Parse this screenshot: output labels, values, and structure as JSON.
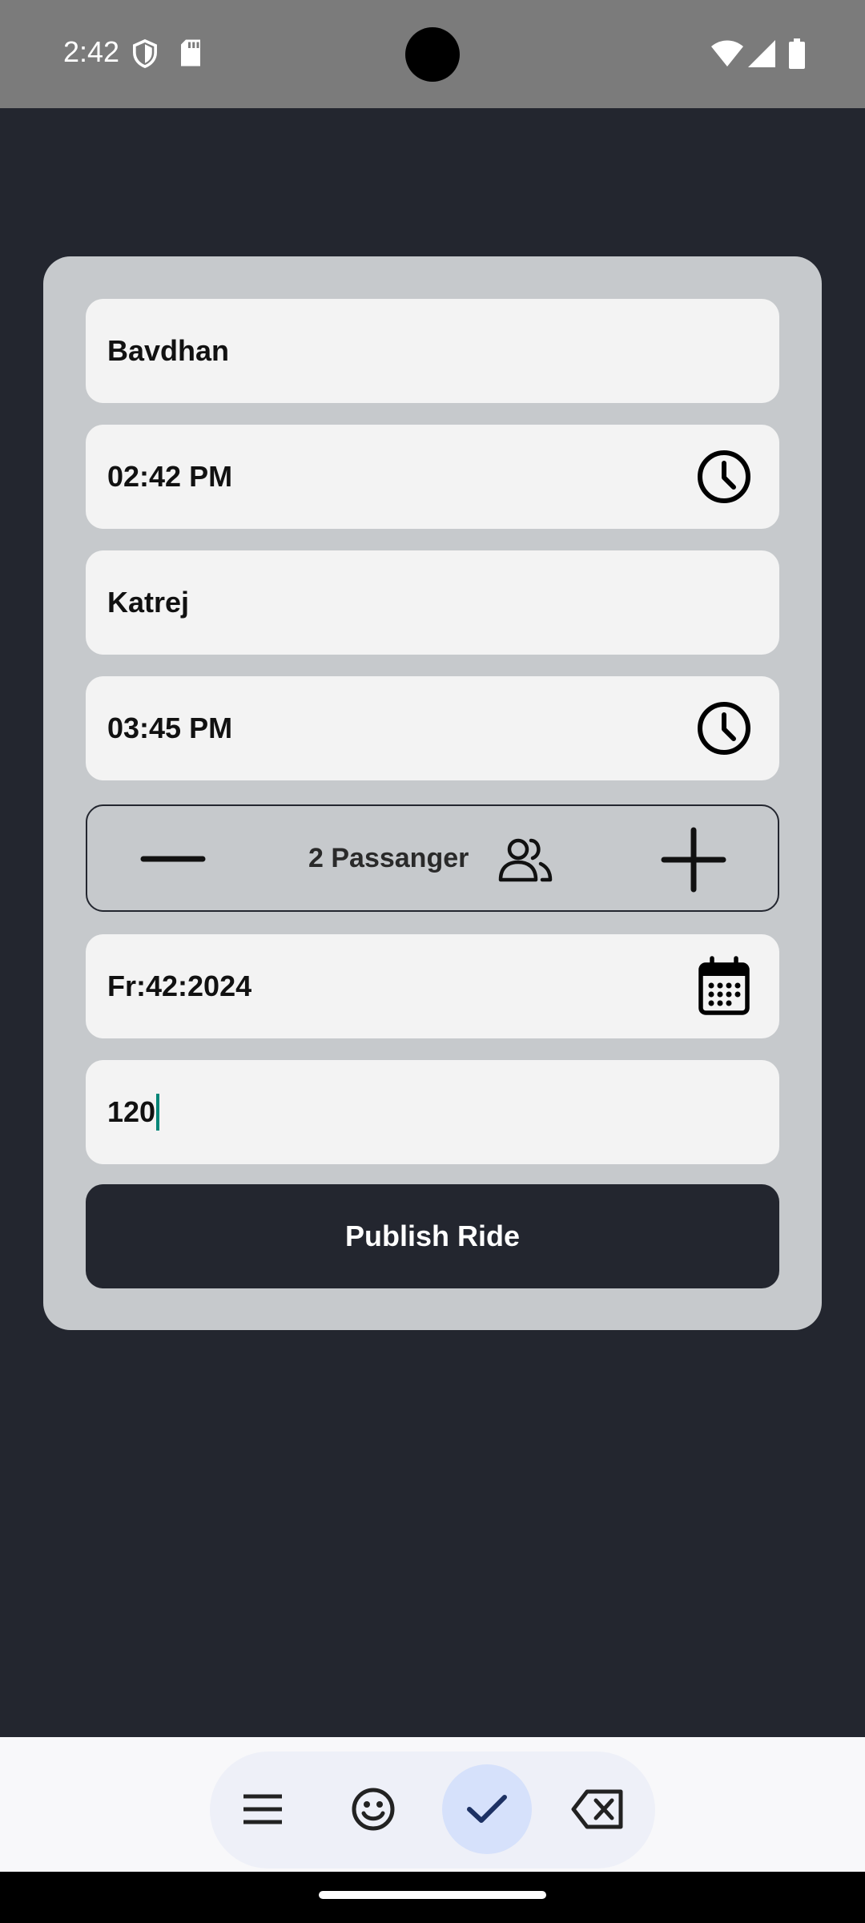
{
  "status_bar": {
    "time": "2:42"
  },
  "form": {
    "from_location": "Bavdhan",
    "departure_time": "02:42 PM",
    "to_location": "Katrej",
    "arrival_time": "03:45 PM",
    "passengers_label": "2 Passanger",
    "date": "Fr:42:2024",
    "price": "120",
    "publish_label": "Publish Ride"
  },
  "icons": {
    "time": "clock-icon",
    "date": "calendar-icon",
    "passengers": "people-icon",
    "decrease": "minus-icon",
    "increase": "plus-icon"
  },
  "keyboard_toolbar": {
    "buttons": [
      "menu-icon",
      "emoji-icon",
      "check-icon",
      "backspace-icon"
    ]
  },
  "colors": {
    "background": "#23262f",
    "card": "#c6c9cc",
    "field": "#f3f3f3",
    "button": "#23262f",
    "cursor": "#008577"
  }
}
